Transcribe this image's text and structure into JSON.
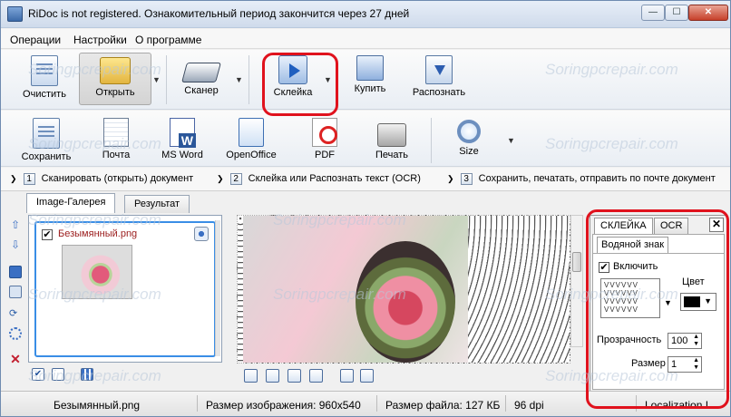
{
  "window": {
    "title": "RiDoc is not registered. Ознакомительный период закончится через 27 дней",
    "controls": {
      "minimize": "—",
      "maximize": "☐",
      "close": "✕"
    }
  },
  "menu": [
    "Операции",
    "Настройки",
    "О программе"
  ],
  "toolbar_top": {
    "clear": "Очистить",
    "open": "Открыть",
    "scanner": "Сканер",
    "glue": "Склейка",
    "buy": "Купить",
    "recognize": "Распознать"
  },
  "toolbar_bottom": {
    "save": "Сохранить",
    "mail": "Почта",
    "word": "MS Word",
    "openoffice": "OpenOffice",
    "pdf": "PDF",
    "print": "Печать",
    "size": "Size"
  },
  "steps": [
    {
      "num": "1",
      "text": "Сканировать (открыть) документ"
    },
    {
      "num": "2",
      "text": "Склейка или Распознать текст (OCR)"
    },
    {
      "num": "3",
      "text": "Сохранить, печатать, отправить по почте документ"
    }
  ],
  "tabs": [
    "Image-Галерея",
    "Результат"
  ],
  "gallery": {
    "file_name": "Безымянный.png",
    "checked": "✔"
  },
  "panel": {
    "tabs": [
      "СКЛЕЙКА",
      "OCR"
    ],
    "close": "✕",
    "subtab": "Водяной знак",
    "enable_label": "Включить",
    "enable_check": "✔",
    "color_label": "Цвет",
    "watermark_pattern": "VVVVVV\nVVVVVV\nVVVVVV\nVVVVVV",
    "transparency_label": "Прозрачность",
    "transparency_value": "100",
    "size_label": "Размер",
    "size_value": "1",
    "spin_arrows": "▲\n▼"
  },
  "status": {
    "file": "Безымянный.png",
    "image_size": "Размер изображения: 960x540",
    "file_size": "Размер файла: 127 КБ",
    "dpi": "96 dpi",
    "localization": "Localization I"
  },
  "watermark_text": "Soringpcrepair.com",
  "colors": {
    "highlight": "#e0121d",
    "accent": "#3a8ee6"
  }
}
